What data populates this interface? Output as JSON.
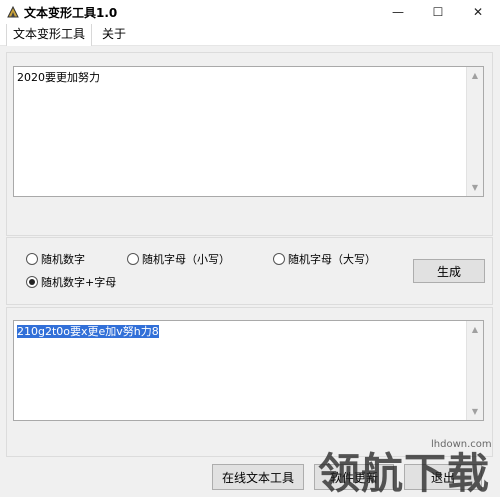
{
  "window": {
    "title": "文本变形工具1.0",
    "controls": {
      "minimize": "—",
      "maximize": "☐",
      "close": "✕"
    }
  },
  "menu": [
    "文本变形工具",
    "关于"
  ],
  "input_text": "2020要更加努力",
  "options": {
    "items": [
      {
        "label": "随机数字",
        "selected": false
      },
      {
        "label": "随机字母（小写）",
        "selected": false
      },
      {
        "label": "随机字母（大写）",
        "selected": false
      },
      {
        "label": "随机数字+字母",
        "selected": true
      }
    ],
    "generate_label": "生成"
  },
  "output_text": "210g2t0o要x更e加v努h力8",
  "bottom_buttons": {
    "online": "在线文本工具",
    "update": "软件更新",
    "exit": "退出"
  },
  "watermark": {
    "text": "领航下载",
    "site": "lhdown.com"
  },
  "colors": {
    "selection": "#3270d8",
    "window_bg": "#f0f0f0"
  }
}
